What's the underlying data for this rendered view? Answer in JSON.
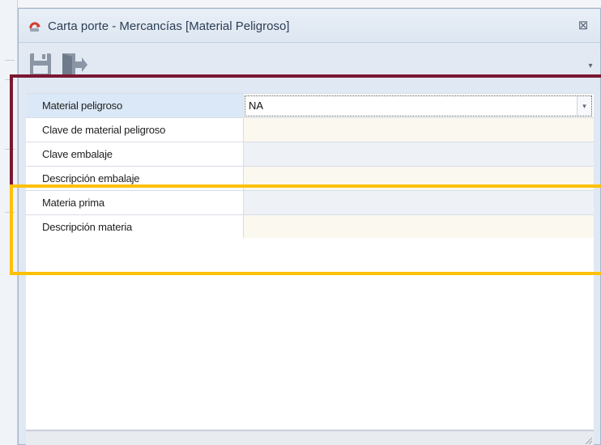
{
  "window": {
    "title": "Carta porte - Mercancías [Material Peligroso]",
    "close_glyph": "⊠"
  },
  "toolbar": {
    "buttons": [
      {
        "icon": "save-icon"
      },
      {
        "icon": "exit-icon"
      }
    ],
    "overflow_glyph": "▾"
  },
  "grid": {
    "rows": [
      {
        "label": "Material peligroso",
        "value": "NA",
        "kind": "combo"
      },
      {
        "label": "Clave de material peligroso",
        "value": "",
        "kind": "cream"
      },
      {
        "label": "Clave embalaje",
        "value": "",
        "kind": "blue"
      },
      {
        "label": "Descripción embalaje",
        "value": "",
        "kind": "cream"
      },
      {
        "label": "Materia prima",
        "value": "",
        "kind": "blue"
      },
      {
        "label": "Descripción materia",
        "value": "",
        "kind": "cream"
      }
    ],
    "combo_arrow_glyph": "▾"
  },
  "colors": {
    "highlight_red": "#7b1832",
    "highlight_yellow": "#ffc107"
  }
}
